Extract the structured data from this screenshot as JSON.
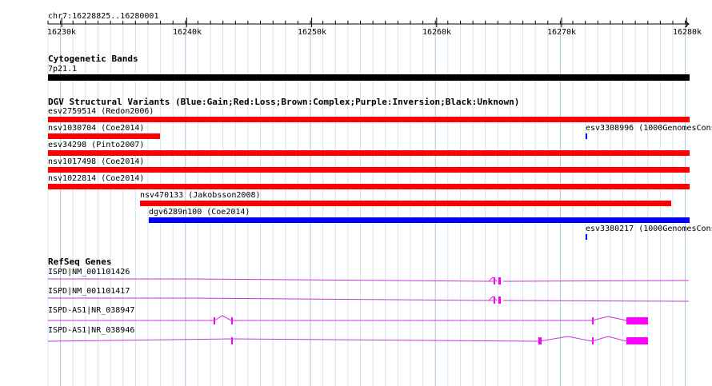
{
  "ruler": {
    "locus": "chr7:16228825..16280001",
    "ticks": [
      "16230k",
      "16240k",
      "16250k",
      "16260k",
      "16270k",
      "16280k"
    ]
  },
  "cytoband_track": {
    "title": "Cytogenetic Bands",
    "band": "7p21.1",
    "color": "#000000"
  },
  "dgv_track": {
    "title": "DGV Structural Variants (Blue:Gain;Red:Loss;Brown:Complex;Purple:Inversion;Black:Unknown)",
    "features": [
      {
        "label": "esv2759514 (Redon2006)",
        "color": "#ff0000"
      },
      {
        "label": "nsv1030704 (Coe2014)",
        "color": "#ff0000"
      },
      {
        "label": "esv3308996 (1000GenomesCons",
        "color": "#0000ff"
      },
      {
        "label": "esv34298 (Pinto2007)",
        "color": "#ff0000"
      },
      {
        "label": "nsv1017498 (Coe2014)",
        "color": "#ff0000"
      },
      {
        "label": "nsv1022814 (Coe2014)",
        "color": "#ff0000"
      },
      {
        "label": "nsv470133 (Jakobsson2008)",
        "color": "#ff0000"
      },
      {
        "label": "dgv6289n100 (Coe2014)",
        "color": "#0000ff"
      },
      {
        "label": "esv3380217 (1000GenomesCons",
        "color": "#0000ff"
      }
    ]
  },
  "refseq_track": {
    "title": "RefSeq Genes",
    "color": "#cc33cc",
    "exon_color": "#ff00ff",
    "genes": [
      {
        "label": "ISPD|NM_001101426"
      },
      {
        "label": "ISPD|NM_001101417"
      },
      {
        "label": "ISPD-AS1|NR_038947"
      },
      {
        "label": "ISPD-AS1|NR_038946"
      }
    ]
  }
}
